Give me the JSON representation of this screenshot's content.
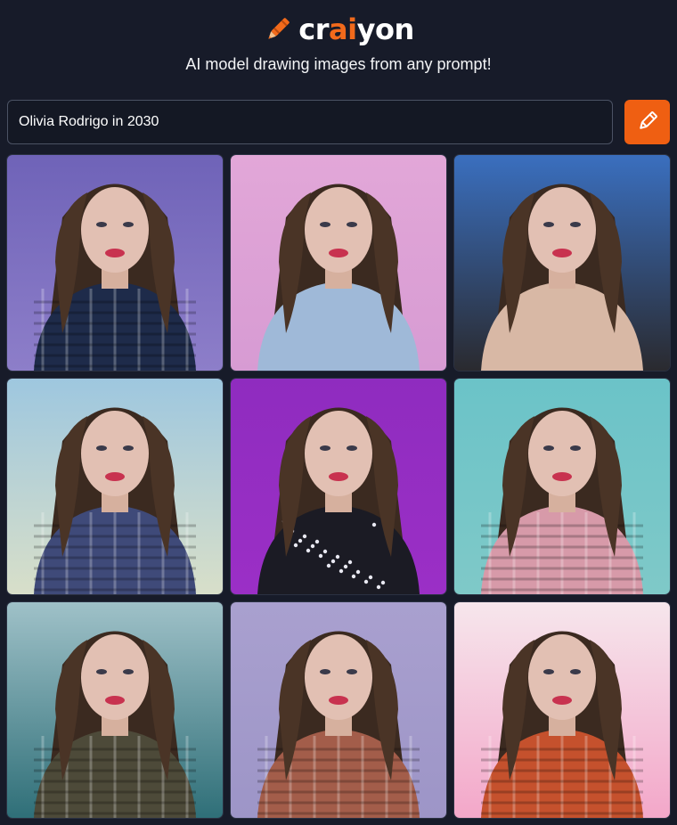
{
  "logo": {
    "prefix": "cr",
    "ai": "ai",
    "suffix": "yon",
    "icon": "crayon-pencil-icon",
    "accent_color": "#f26a1b"
  },
  "tagline": "AI model drawing images from any prompt!",
  "prompt": {
    "value": "Olivia Rodrigo in 2030",
    "draw_button_icon": "pencil-icon",
    "button_color": "#ef5f12"
  },
  "results": [
    {
      "bg": "#8d7ec9",
      "top": "#6f63b8",
      "shirt": "#1e2b4a",
      "pattern": "plaid"
    },
    {
      "bg": "#d79bd3",
      "top": "#e2a7d8",
      "shirt": "#9fb9d8",
      "pattern": "plain"
    },
    {
      "bg": "#2a2a2f",
      "top": "#3a6fbf",
      "shirt": "#d8b8a5",
      "pattern": "skin"
    },
    {
      "bg": "#d8dfc9",
      "top": "#9ec7df",
      "shirt": "#3f4a79",
      "pattern": "plaid"
    },
    {
      "bg": "#9b2fc6",
      "top": "#8f2cbf",
      "shirt": "#1b1b24",
      "pattern": "sparkle"
    },
    {
      "bg": "#7fc9c8",
      "top": "#6bc3c8",
      "shirt": "#d79aa9",
      "pattern": "plaid"
    },
    {
      "bg": "#2f6f78",
      "top": "#9fc1c8",
      "shirt": "#4d4a39",
      "pattern": "plaid"
    },
    {
      "bg": "#9d95c7",
      "top": "#a9a0cf",
      "shirt": "#a35d4a",
      "pattern": "plaid"
    },
    {
      "bg": "#f3a7c9",
      "top": "#f6e6ec",
      "shirt": "#c5512d",
      "pattern": "plaid"
    }
  ]
}
